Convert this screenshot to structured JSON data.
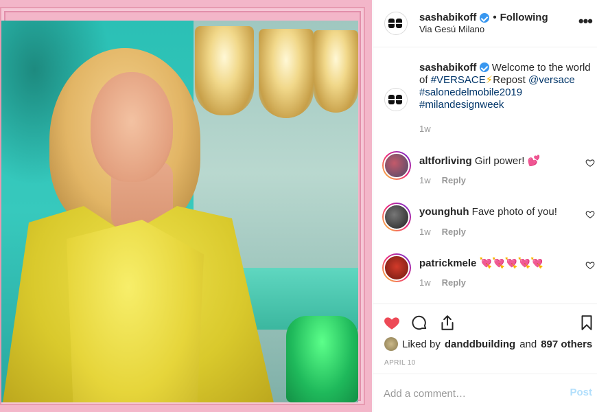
{
  "post": {
    "username": "sashabikoff",
    "following_label": "Following",
    "separator": "•",
    "location": "Via Gesú Milano",
    "more_label": "•••"
  },
  "caption": {
    "username": "sashabikoff",
    "text_1": "Welcome to the world of",
    "hashtag_1": "#VERSACE",
    "bolt": "⚡",
    "text_2": "Repost",
    "mention": "@versace",
    "hashtag_2": "#salonedelmobile2019",
    "hashtag_3": "#milandesignweek",
    "time": "1w"
  },
  "comments": [
    {
      "username": "altforliving",
      "text": "Girl power! 💕",
      "time": "1w",
      "reply": "Reply"
    },
    {
      "username": "younghuh",
      "text": "Fave photo of you!",
      "time": "1w",
      "reply": "Reply"
    },
    {
      "username": "patrickmele",
      "text": "💘💘💘💘💘",
      "time": "1w",
      "reply": "Reply"
    }
  ],
  "likes": {
    "prefix": "Liked by",
    "user": "danddbuilding",
    "conj": "and",
    "others": "897 others"
  },
  "date": "APRIL 10",
  "add_comment": {
    "placeholder": "Add a comment…",
    "post_label": "Post"
  },
  "colors": {
    "verified": "#3897f0",
    "like_red": "#ed4956",
    "link": "#003569",
    "post_disabled": "#b2dffc",
    "frame_pink": "#f3b6c9"
  },
  "icons": [
    "verified-badge-icon",
    "more-options-icon",
    "heart-icon",
    "comment-icon",
    "share-icon",
    "bookmark-icon"
  ]
}
